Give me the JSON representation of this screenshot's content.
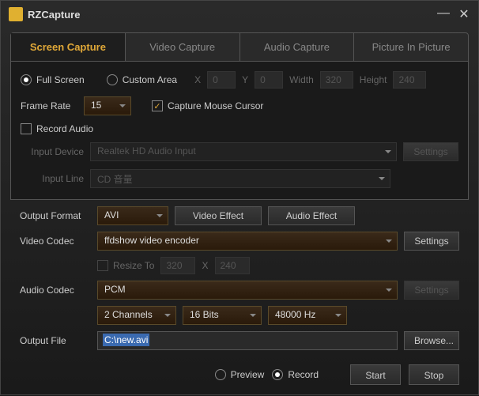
{
  "app": {
    "title": "RZCapture"
  },
  "tabs": {
    "screen": "Screen Capture",
    "video": "Video Capture",
    "audio": "Audio Capture",
    "pip": "Picture In Picture"
  },
  "capture": {
    "full_screen": "Full Screen",
    "custom_area": "Custom Area",
    "x_label": "X",
    "x_value": "0",
    "y_label": "Y",
    "y_value": "0",
    "width_label": "Width",
    "width_value": "320",
    "height_label": "Height",
    "height_value": "240",
    "frame_rate_label": "Frame Rate",
    "frame_rate_value": "15",
    "mouse_cursor": "Capture Mouse Cursor",
    "record_audio": "Record Audio",
    "input_device_label": "Input Device",
    "input_device_value": "Realtek HD Audio Input",
    "input_line_label": "Input Line",
    "input_line_value": "CD 音量",
    "settings": "Settings"
  },
  "output": {
    "format_label": "Output Format",
    "format_value": "AVI",
    "video_effect": "Video Effect",
    "audio_effect": "Audio Effect",
    "video_codec_label": "Video Codec",
    "video_codec_value": "ffdshow video encoder",
    "settings": "Settings",
    "resize_label": "Resize To",
    "resize_w": "320",
    "resize_x": "X",
    "resize_h": "240",
    "audio_codec_label": "Audio Codec",
    "audio_codec_value": "PCM",
    "channels": "2 Channels",
    "bits": "16 Bits",
    "hz": "48000 Hz",
    "file_label": "Output File",
    "file_value": "C:\\new.avi",
    "browse": "Browse..."
  },
  "bottom": {
    "preview": "Preview",
    "record": "Record",
    "start": "Start",
    "stop": "Stop"
  }
}
